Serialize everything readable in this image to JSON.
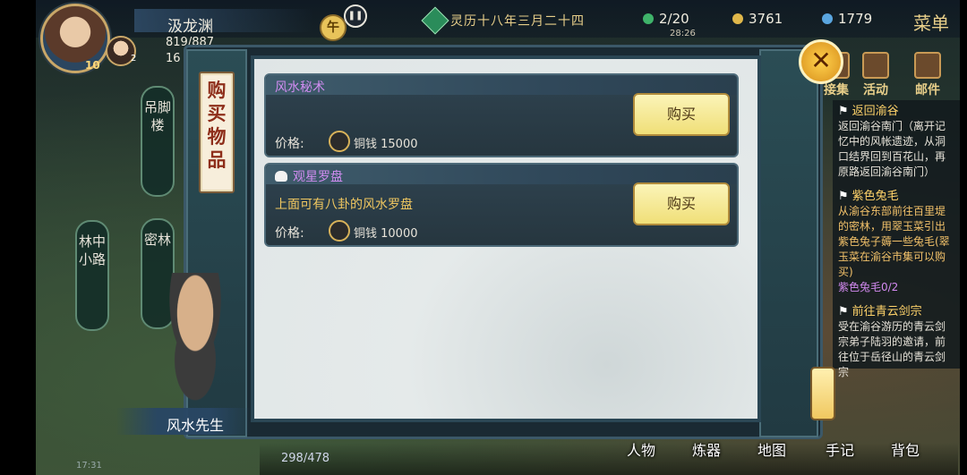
{
  "player": {
    "name": "汲龙渊",
    "hp": "819/887",
    "mp": "16",
    "level": "10",
    "companion_level": "2"
  },
  "time_badge": "午",
  "date": "灵历十八年三月二十四",
  "stats": {
    "stamina": "2/20",
    "stamina_timer": "28:26",
    "copper": "3761",
    "spirit": "1779"
  },
  "menu_label": "菜单",
  "top_icons": [
    {
      "label": "接集"
    },
    {
      "label": "活动"
    },
    {
      "label": "邮件"
    }
  ],
  "locations": [
    {
      "label": "吊脚楼"
    },
    {
      "label": "林中小路"
    },
    {
      "label": "密林"
    }
  ],
  "shop": {
    "tab_title": "购买物品",
    "items": [
      {
        "name": "风水秘术",
        "description": "",
        "price_label": "价格:",
        "price": "铜钱 15000",
        "buy_label": "购买"
      },
      {
        "name": "观星罗盘",
        "description": "上面可有八卦的风水罗盘",
        "price_label": "价格:",
        "price": "铜钱 10000",
        "buy_label": "购买"
      }
    ]
  },
  "quests": [
    {
      "title": "返回渝谷",
      "desc": "返回渝谷南门（离开记忆中的风帐遗迹，从洞口结界回到百花山，再原路返回渝谷南门）",
      "progress": ""
    },
    {
      "title": "紫色兔毛",
      "desc": "从渝谷东部前往百里堤的密林，用翠玉菜引出紫色兔子薅一些兔毛(翠玉菜在渝谷市集可以购买)",
      "progress": "紫色兔毛0/2"
    },
    {
      "title": "前往青云剑宗",
      "desc": "受在渝谷游历的青云剑宗弟子陆羽的邀请，前往位于岳径山的青云剑宗",
      "progress": ""
    }
  ],
  "npc": {
    "name": "风水先生"
  },
  "bottom": {
    "exp": "298/478",
    "nav": [
      "人物",
      "炼器",
      "地图",
      "手记",
      "背包"
    ],
    "sys_time": "17:31"
  }
}
